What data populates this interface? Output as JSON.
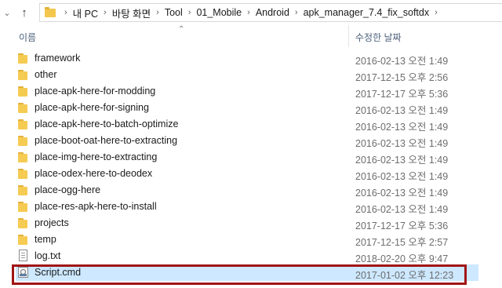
{
  "address_bar": {
    "breadcrumbs": [
      "내 PC",
      "바탕 화면",
      "Tool",
      "01_Mobile",
      "Android",
      "apk_manager_7.4_fix_softdx"
    ]
  },
  "columns": {
    "name": "이름",
    "date_modified": "수정한 날짜"
  },
  "files": [
    {
      "name": "framework",
      "date": "2016-02-13 오전 1:49",
      "type": "folder"
    },
    {
      "name": "other",
      "date": "2017-12-15 오후 2:56",
      "type": "folder"
    },
    {
      "name": "place-apk-here-for-modding",
      "date": "2017-12-17 오후 5:36",
      "type": "folder"
    },
    {
      "name": "place-apk-here-for-signing",
      "date": "2016-02-13 오전 1:49",
      "type": "folder"
    },
    {
      "name": "place-apk-here-to-batch-optimize",
      "date": "2016-02-13 오전 1:49",
      "type": "folder"
    },
    {
      "name": "place-boot-oat-here-to-extracting",
      "date": "2016-02-13 오전 1:49",
      "type": "folder"
    },
    {
      "name": "place-img-here-to-extracting",
      "date": "2016-02-13 오전 1:49",
      "type": "folder"
    },
    {
      "name": "place-odex-here-to-deodex",
      "date": "2016-02-13 오전 1:49",
      "type": "folder"
    },
    {
      "name": "place-ogg-here",
      "date": "2016-02-13 오전 1:49",
      "type": "folder"
    },
    {
      "name": "place-res-apk-here-to-install",
      "date": "2016-02-13 오전 1:49",
      "type": "folder"
    },
    {
      "name": "projects",
      "date": "2017-12-17 오후 5:36",
      "type": "folder"
    },
    {
      "name": "temp",
      "date": "2017-12-15 오후 2:57",
      "type": "folder"
    },
    {
      "name": "log.txt",
      "date": "2018-02-20 오후 9:47",
      "type": "txt"
    },
    {
      "name": "Script.cmd",
      "date": "2017-01-02 오후 12:23",
      "type": "cmd",
      "selected": true
    }
  ],
  "colors": {
    "selection": "#cde8ff",
    "highlight_border": "#a01515",
    "folder": "#f6cb52",
    "header_text": "#4c607a"
  }
}
